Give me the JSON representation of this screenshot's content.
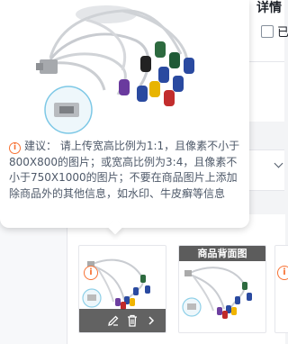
{
  "form": {
    "section_title": "详情",
    "checkbox_label": "已"
  },
  "tooltip": {
    "suggestion_label": "建议：",
    "suggestion_text": "请上传宽高比例为1:1，且像素不小于800X800的图片；或宽高比例为3:4，且像素不小于750X1000的图片；不要在商品图片上添加除商品外的其他信息，如水印、牛皮癣等信息"
  },
  "thumbnails": {
    "back_label": "商品背面图",
    "warn_symbol": "i"
  },
  "colors": {
    "warning": "#f77234",
    "toolbar": "#464646"
  }
}
